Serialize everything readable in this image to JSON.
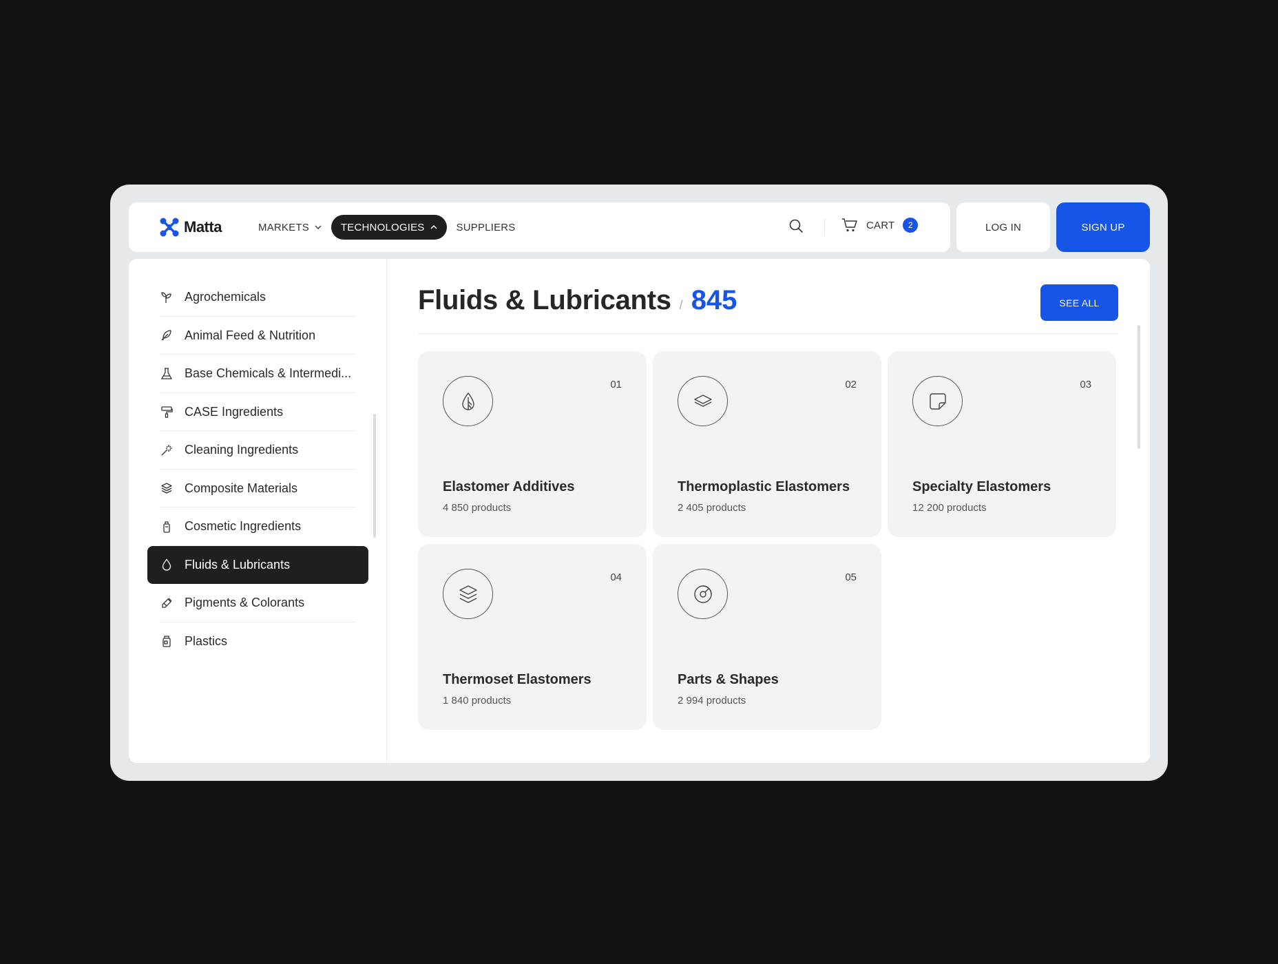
{
  "brand": {
    "name": "Matta",
    "accent": "#1755e8"
  },
  "nav": {
    "items": [
      {
        "label": "MARKETS",
        "icon": "chevron-down-icon"
      },
      {
        "label": "TECHNOLOGIES",
        "icon": "chevron-up-icon",
        "active": true
      },
      {
        "label": "SUPPLIERS"
      }
    ]
  },
  "header": {
    "cart_label": "CART",
    "cart_count": "2",
    "login_label": "LOG IN",
    "signup_label": "SIGN UP"
  },
  "sidebar": {
    "items": [
      {
        "label": "Agrochemicals",
        "icon": "sprout-icon"
      },
      {
        "label": "Animal Feed & Nutrition",
        "icon": "feather-icon"
      },
      {
        "label": "Base Chemicals & Intermedi...",
        "icon": "flask-icon"
      },
      {
        "label": "CASE Ingredients",
        "icon": "paint-roller-icon"
      },
      {
        "label": "Cleaning Ingredients",
        "icon": "sparkle-icon"
      },
      {
        "label": "Composite Materials",
        "icon": "layers-icon"
      },
      {
        "label": "Cosmetic Ingredients",
        "icon": "bottle-icon"
      },
      {
        "label": "Fluids & Lubricants",
        "icon": "drop-icon",
        "active": true
      },
      {
        "label": "Pigments & Colorants",
        "icon": "pipette-icon"
      },
      {
        "label": "Plastics",
        "icon": "container-icon"
      }
    ]
  },
  "main": {
    "title": "Fluids & Lubricants",
    "separator": "/",
    "count": "845",
    "see_all_label": "SEE ALL",
    "cards": [
      {
        "num": "01",
        "title": "Elastomer Additives",
        "sub": "4 850 products",
        "icon": "leaf-drop-icon"
      },
      {
        "num": "02",
        "title": "Thermoplastic Elastomers",
        "sub": "2 405 products",
        "icon": "layer-icon"
      },
      {
        "num": "03",
        "title": "Specialty Elastomers",
        "sub": "12 200 products",
        "icon": "sticker-icon"
      },
      {
        "num": "04",
        "title": "Thermoset Elastomers",
        "sub": "1 840 products",
        "icon": "layers-stack-icon"
      },
      {
        "num": "05",
        "title": "Parts & Shapes",
        "sub": "2 994 products",
        "icon": "disc-icon"
      }
    ]
  }
}
